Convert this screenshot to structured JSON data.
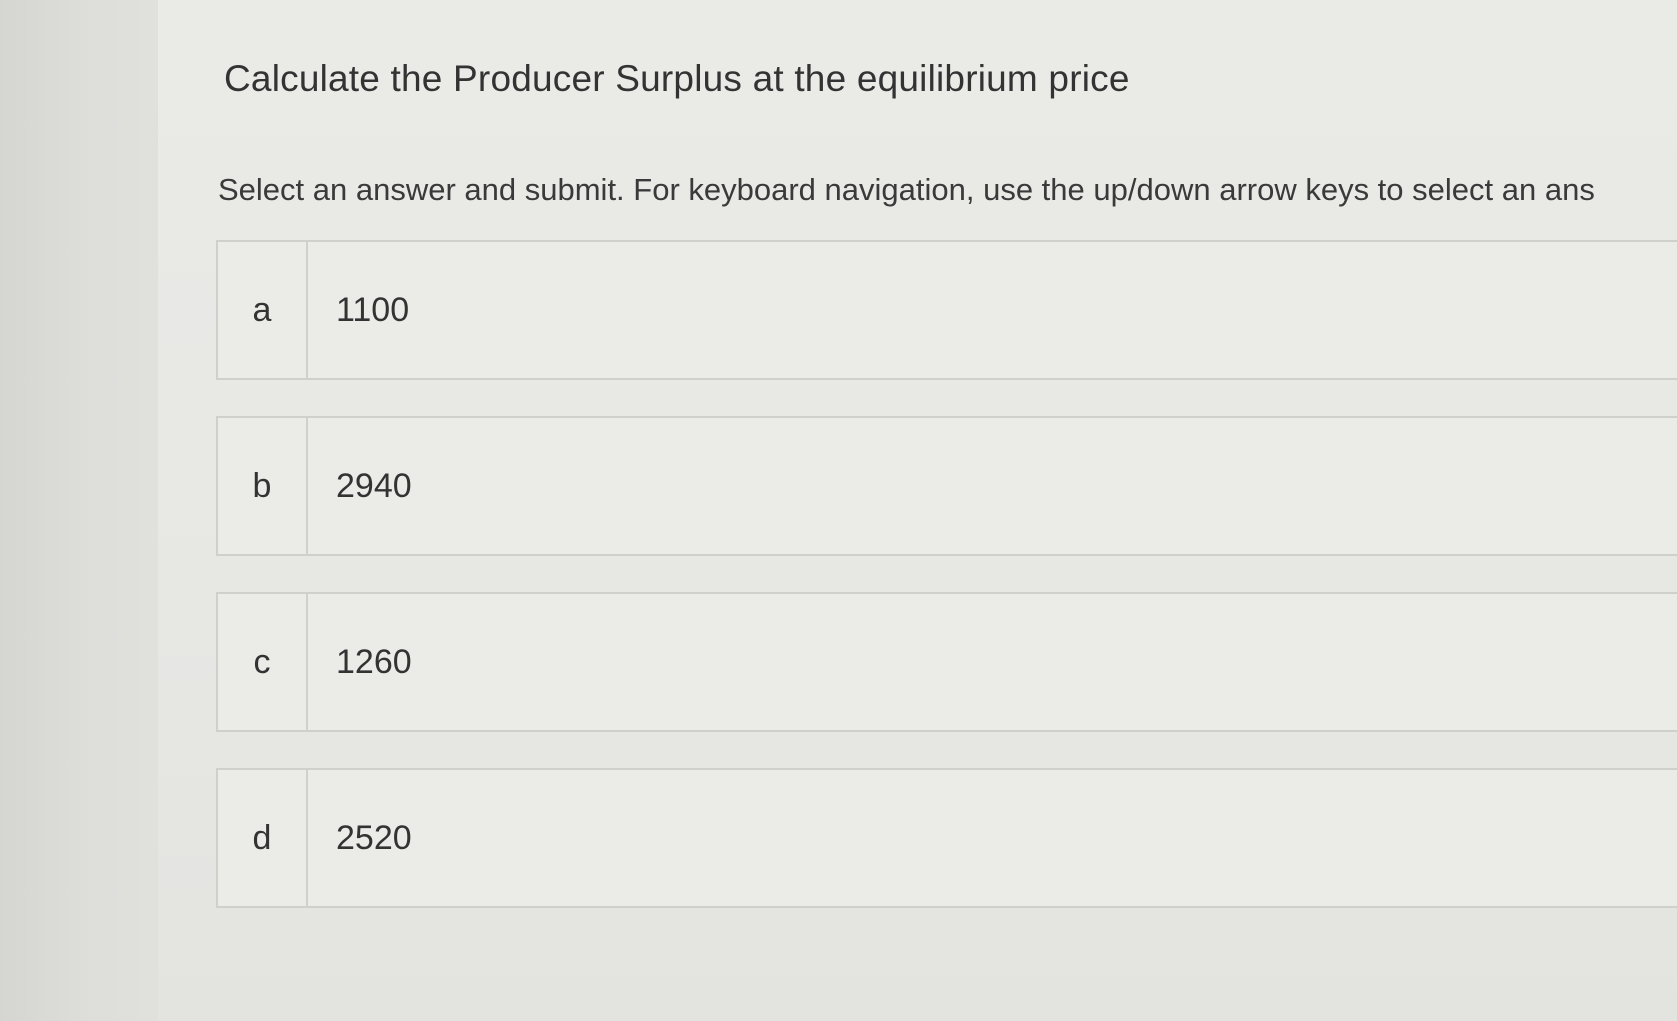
{
  "question": {
    "title": "Calculate the Producer Surplus at the equilibrium price",
    "instructions": "Select an answer and submit. For keyboard navigation, use the up/down arrow keys to select an ans"
  },
  "answers": [
    {
      "letter": "a",
      "value": "1100"
    },
    {
      "letter": "b",
      "value": "2940"
    },
    {
      "letter": "c",
      "value": "1260"
    },
    {
      "letter": "d",
      "value": "2520"
    }
  ]
}
